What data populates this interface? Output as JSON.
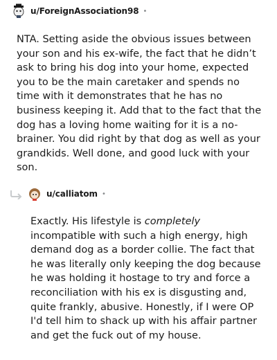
{
  "comments": [
    {
      "username": "u/ForeignAssociation98",
      "separator": "•",
      "avatar_icon": "snoo-hat-avatar-icon",
      "body": "NTA. Setting aside the obvious issues between your son and his ex-wife, the fact that he didn’t ask to bring his dog into your home, expected you to be the main caretaker and spends no time with it demonstrates that he has no business keeping it. Add that to the fact that the dog has a loving home waiting for it is a no-brainer. You did right by that dog as well as your grandkids. Well done, and good luck with your son."
    },
    {
      "username": "u/calliatom",
      "separator": "•",
      "avatar_icon": "snoo-brown-hair-avatar-icon",
      "reply_icon": "reply-arrow-icon",
      "body_before": "Exactly. His lifestyle is ",
      "body_emphasis": "completely",
      "body_after": " incompatible with such a high energy, high demand dog as a border collie. The fact that he was literally only keeping the dog because he was holding it hostage to try and force a reconciliation with his ex is disgusting and, quite frankly, abusive. Honestly, if I were OP I'd tell him to shack up with his affair partner and get the fuck out of my house."
    }
  ],
  "colors": {
    "text": "#1c1c1c",
    "meta": "#878a8c",
    "reply_arrow": "#c8cbcd"
  }
}
